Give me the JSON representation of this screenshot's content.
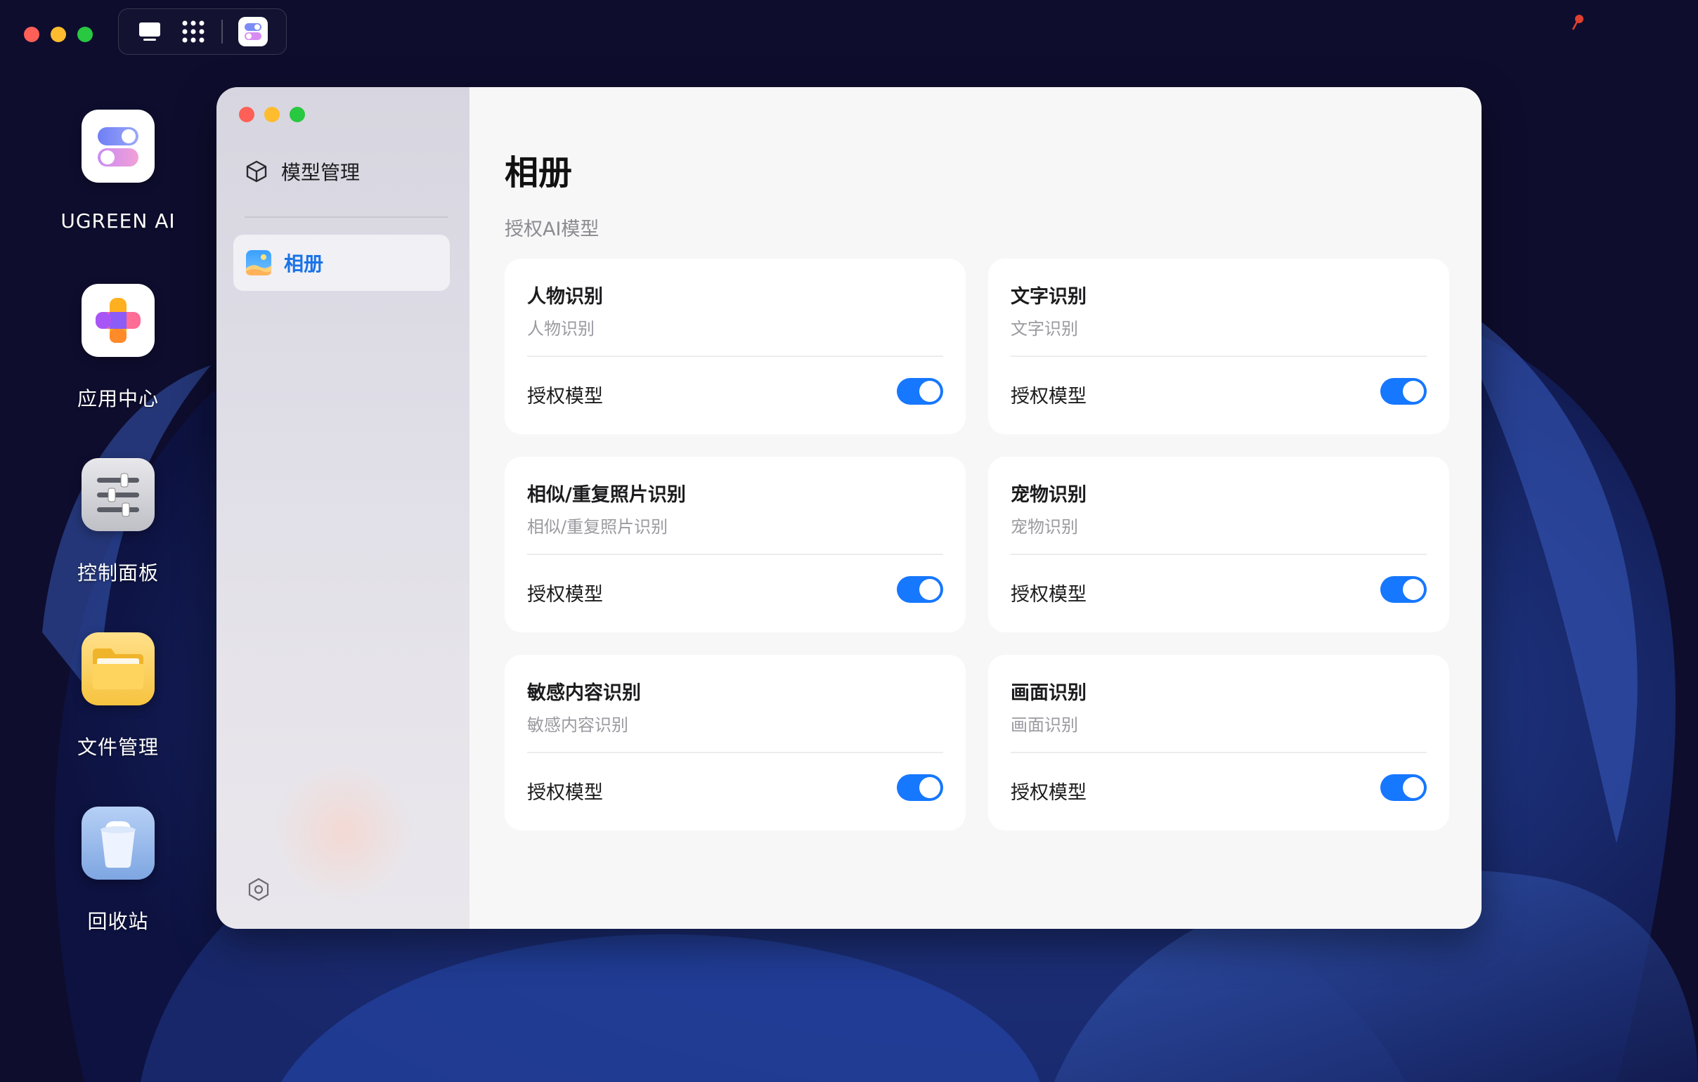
{
  "desktop": {
    "icons": [
      {
        "label": "UGREEN AI",
        "icon": "ugreen-ai-toggle-icon"
      },
      {
        "label": "应用中心",
        "icon": "app-center-icon"
      },
      {
        "label": "控制面板",
        "icon": "sliders-icon"
      },
      {
        "label": "文件管理",
        "icon": "folder-icon"
      },
      {
        "label": "回收站",
        "icon": "trash-bin-icon"
      }
    ]
  },
  "topbar": {
    "icons": [
      "desktop-monitor-icon",
      "apps-grid-icon",
      "ugreen-ai-app-icon"
    ]
  },
  "window": {
    "sidebar": {
      "section_title": "模型管理",
      "nav_items": [
        {
          "label": "相册",
          "icon": "photo-album-icon",
          "active": true
        }
      ]
    },
    "content": {
      "title": "相册",
      "subtitle": "授权AI模型",
      "cards": [
        {
          "title": "人物识别",
          "subtitle": "人物识别",
          "toggle_label": "授权模型",
          "enabled": true
        },
        {
          "title": "文字识别",
          "subtitle": "文字识别",
          "toggle_label": "授权模型",
          "enabled": true
        },
        {
          "title": "相似/重复照片识别",
          "subtitle": "相似/重复照片识别",
          "toggle_label": "授权模型",
          "enabled": true
        },
        {
          "title": "宠物识别",
          "subtitle": "宠物识别",
          "toggle_label": "授权模型",
          "enabled": true
        },
        {
          "title": "敏感内容识别",
          "subtitle": "敏感内容识别",
          "toggle_label": "授权模型",
          "enabled": true
        },
        {
          "title": "画面识别",
          "subtitle": "画面识别",
          "toggle_label": "授权模型",
          "enabled": true
        }
      ]
    }
  },
  "colors": {
    "accent": "#1677ff",
    "desktop_bg": "#0e0d2e",
    "content_bg": "#f7f7f8"
  }
}
